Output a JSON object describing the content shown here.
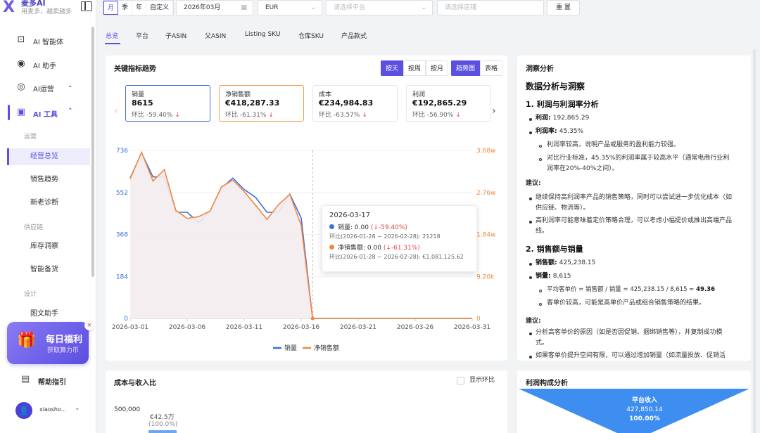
{
  "brand": {
    "logo_mark": "X",
    "name": "麦多AI",
    "slogan": "用麦多，越卖越多"
  },
  "sidebar": {
    "items": [
      {
        "label": "AI 智能体",
        "icon": "robot-icon"
      },
      {
        "label": "AI 助手",
        "icon": "assistant-icon"
      },
      {
        "label": "AI运营",
        "icon": "target-icon",
        "chevron": "⌄"
      },
      {
        "label": "AI 工具",
        "icon": "chart-icon",
        "chevron": "⌃"
      }
    ],
    "groups": [
      "运营",
      "供应链",
      "设计"
    ],
    "sub_items": [
      "经营总览",
      "销售趋势",
      "新老诊断",
      "库存洞察",
      "智能备货",
      "图文助手"
    ],
    "promo": {
      "title": "每日福利",
      "subtitle": "获取算力币",
      "close": "×"
    },
    "help": "帮助指引",
    "user": {
      "avatar": "👤",
      "name": "xiaosho..."
    }
  },
  "filters": {
    "period_options": [
      "月",
      "季",
      "年",
      "自定义"
    ],
    "month": "2026年03月",
    "currency": "EUR",
    "platform_placeholder": "请选择平台",
    "store_placeholder": "请选择店铺",
    "reset": "重 置"
  },
  "tabs": [
    "总览",
    "平台",
    "子ASIN",
    "父ASIN",
    "Listing SKU",
    "仓库SKU",
    "产品款式"
  ],
  "trend": {
    "title": "关键指标趋势",
    "granularity": [
      "按天",
      "按周",
      "按月"
    ],
    "view": [
      "趋势图",
      "表格"
    ],
    "metrics": [
      {
        "name": "销量",
        "value": "8615",
        "change_label": "环比",
        "change": "-59.40%",
        "arrow": "↓"
      },
      {
        "name": "净销售额",
        "value": "€418,287.33",
        "change_label": "环比",
        "change": "-61.31%",
        "arrow": "↓"
      },
      {
        "name": "成本",
        "value": "€234,984.83",
        "change_label": "环比",
        "change": "-63.57%",
        "arrow": "↓"
      },
      {
        "name": "利润",
        "value": "€192,865.29",
        "change_label": "环比",
        "change": "-56.90%",
        "arrow": "↓"
      }
    ],
    "prev_arrow": "‹",
    "next_arrow": "›",
    "tooltip": {
      "date": "2026-03-17",
      "sales_label": "销量: 0.00",
      "sales_change": "(↓-59.40%)",
      "sales_sub": "环比(2026-01-28 ~ 2026-02-28): 21218",
      "net_label": "净销售额: 0.00",
      "net_change": "(↓-61.31%)",
      "net_sub": "环比(2026-01-28 ~ 2026-02-28): €1,081,125.62"
    }
  },
  "chart_data": {
    "type": "line",
    "x": [
      "2026-03-01",
      "2026-03-02",
      "2026-03-03",
      "2026-03-04",
      "2026-03-05",
      "2026-03-06",
      "2026-03-07",
      "2026-03-08",
      "2026-03-09",
      "2026-03-10",
      "2026-03-11",
      "2026-03-12",
      "2026-03-13",
      "2026-03-14",
      "2026-03-15",
      "2026-03-16",
      "2026-03-17",
      "2026-03-18",
      "2026-03-19",
      "2026-03-20",
      "2026-03-21",
      "2026-03-22",
      "2026-03-23",
      "2026-03-24",
      "2026-03-25",
      "2026-03-26",
      "2026-03-27",
      "2026-03-28",
      "2026-03-29",
      "2026-03-30",
      "2026-03-31"
    ],
    "xticks": [
      "2026-03-01",
      "2026-03-06",
      "2026-03-11",
      "2026-03-16",
      "2026-03-21",
      "2026-03-26",
      "2026-03-31"
    ],
    "y_left_ticks": [
      "0",
      "184",
      "368",
      "552",
      "736"
    ],
    "y_right_ticks": [
      "0",
      "9.20k",
      "1.84w",
      "2.76w",
      "3.68w"
    ],
    "ylim_left": [
      0,
      736
    ],
    "ylim_right": [
      0,
      36800
    ],
    "series": [
      {
        "name": "销量",
        "color": "#3b6fd8",
        "axis": "left",
        "values": [
          615,
          725,
          620,
          620,
          465,
          465,
          420,
          470,
          570,
          615,
          565,
          530,
          465,
          465,
          545,
          440,
          0,
          0,
          0,
          0,
          0,
          0,
          0,
          0,
          0,
          0,
          0,
          0,
          0,
          0,
          0
        ]
      },
      {
        "name": "净销售额",
        "color": "#f0883e",
        "axis": "right",
        "values": [
          30600,
          36400,
          30100,
          32600,
          23700,
          21900,
          22300,
          23500,
          28800,
          30300,
          27800,
          24800,
          21700,
          24900,
          27200,
          20400,
          0,
          0,
          0,
          0,
          0,
          0,
          0,
          0,
          0,
          0,
          0,
          0,
          0,
          0,
          0
        ]
      }
    ],
    "tooltip_index": 16,
    "legend": "bottom"
  },
  "insight": {
    "title": "洞察分析",
    "h1": "数据分析与洞察",
    "sec1": "1. 利润与利润率分析",
    "profit_label": "利润",
    "profit_value": "192,865.29",
    "margin_label": "利润率",
    "margin_value": "45.35%",
    "sub1": "利润率较高，说明产品或服务的盈利能力较强。",
    "sub2a": "对比行业标准，45.35%的利润率属于较高水平（通常电商行业利",
    "sub2b": "润率在20%-40%之间）。",
    "advice": "建议:",
    "adv1a": "继续保持高利润率产品的销售策略，同时可以尝试进一步优化成本（如",
    "adv1b": "供应链、物流等）。",
    "adv2a": "高利润率可能意味着定价策略合理，可以考虑小幅提价或推出高端产品",
    "adv2b": "线。",
    "sec2": "2. 销售额与销量",
    "rev_label": "销售额",
    "rev_value": "425,238.15",
    "qty_label": "销量",
    "qty_value": "8,615",
    "sub3a": "平均客单价 = 销售额 / 销量 = 425,238.15 / 8,615 ≈ ",
    "sub3b": "49.36",
    "sub4": "客单价较高，可能是高单价产品或组合销售策略的结果。",
    "advice2": "建议:",
    "adv3a": "分析高客单价的原因（如是否因促销、捆绑销售等），并复制成功模",
    "adv3b": "式。",
    "adv4a": "如果客单价提升空间有限，可以通过增加销量（如流量投放、促销活"
  },
  "cost_card": {
    "title": "成本与收入比",
    "show_mom": "显示环比",
    "y_tick": "500,000",
    "bar_value": "€42.5万",
    "bar_pct": "(100.0%)"
  },
  "profit_card": {
    "title": "利润构成分析",
    "label": "平台收入",
    "value": "427,850.14",
    "pct": "100.00%"
  }
}
